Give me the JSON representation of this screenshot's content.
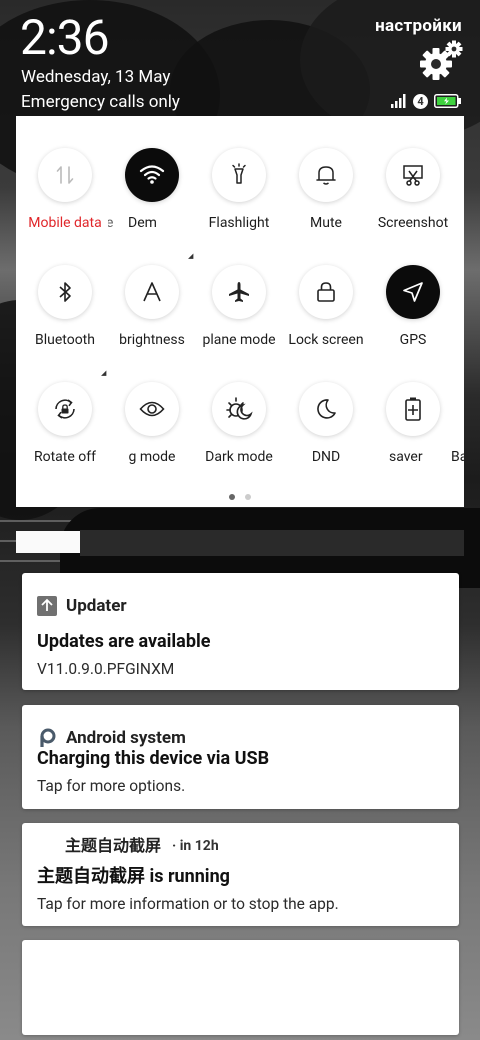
{
  "status": {
    "time": "2:36",
    "date": "Wednesday, 13 May",
    "network_status": "Emergency calls only",
    "settings_label": "настройки",
    "sim_badge": "4"
  },
  "quick_settings": {
    "row1": [
      "Mobile data",
      "e",
      "Dem",
      "Flashlight",
      "Mute",
      "Screenshot"
    ],
    "row2": [
      "Bluetooth",
      "brightness",
      "plane mode",
      "Lock screen",
      "GPS"
    ],
    "row3": [
      "Rotate off",
      "g mode",
      "Dark mode",
      "DND",
      "saver",
      "Ba"
    ]
  },
  "notifications": [
    {
      "app": "Updater",
      "title": "Updates are available",
      "text": "V11.0.9.0.PFGINXM"
    },
    {
      "app": "Android system",
      "title": "Charging this device via USB",
      "text": "Tap for more options."
    },
    {
      "app": "主题自动截屏",
      "time": "· in 12h",
      "title": "主题自动截屏 is running",
      "text": "Tap for more information or to stop the app."
    }
  ],
  "colors": {
    "active_label": "#e0262a",
    "tile_on": "#0b0b0b"
  }
}
